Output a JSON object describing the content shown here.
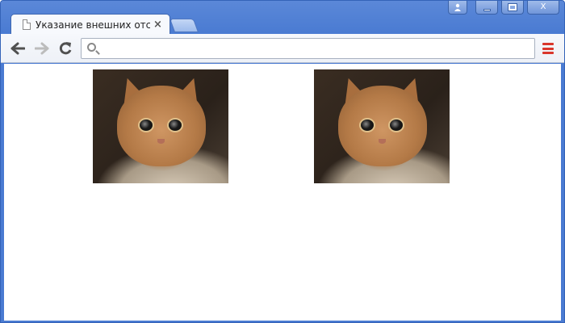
{
  "window": {
    "controls": {
      "user_icon": "user-icon",
      "minimize_icon": "minimize-icon",
      "maximize_icon": "maximize-icon",
      "close_label": "X"
    }
  },
  "tabs": [
    {
      "title": "Указание внешних отступов",
      "close_label": "×"
    }
  ],
  "toolbar": {
    "back_icon": "arrow-left-icon",
    "forward_icon": "arrow-right-icon",
    "reload_icon": "reload-icon",
    "omnibox": {
      "value": "",
      "placeholder": ""
    },
    "menu_icon": "hamburger-menu-icon"
  },
  "content": {
    "images": [
      {
        "subject": "cat-photo"
      },
      {
        "subject": "cat-photo"
      }
    ]
  },
  "colors": {
    "frame": "#4a7bd2",
    "menu_accent": "#d9362b"
  }
}
